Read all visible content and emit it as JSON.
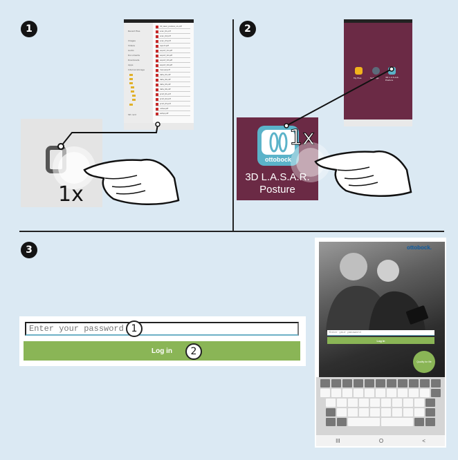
{
  "steps": {
    "step1": "1",
    "step2": "2",
    "step3": "3"
  },
  "panel1": {
    "tap_count": "1x",
    "sidebar_labels": [
      "Recent files",
      "Images",
      "Videos",
      "Audio",
      "Documents",
      "Downloads",
      "Apps",
      "Internal storage",
      "SD card"
    ],
    "files": [
      "3d_lasar_posture_v1.pdf",
      "scan_01.pdf",
      "scan_02.pdf",
      "scan_03.pdf",
      "report.pdf",
      "export_01.pdf",
      "export_02.pdf",
      "export_03.pdf",
      "export_04.pdf",
      "manual.pdf",
      "data_01.pdf",
      "data_02.pdf",
      "data_03.pdf",
      "data_04.pdf",
      "print_01.pdf",
      "print_02.pdf",
      "print_03.pdf",
      "notes.pdf",
      "setup.pdf"
    ]
  },
  "panel2": {
    "tap_count": "1x",
    "app_name": "3D L.A.S.A.R. Posture",
    "icon_brand": "ottobock",
    "home_apps": [
      "My files",
      "Settings",
      "3D L.A.S.A.R. Posture"
    ]
  },
  "panel3": {
    "password_placeholder": "Enter your password",
    "login_label": "Log in",
    "marker_input": "1",
    "marker_button": "2",
    "tablet": {
      "logo": "ottobock.",
      "password_placeholder": "Enter your password",
      "login_label": "Log in",
      "badge": "Quality for life",
      "nav": [
        "III",
        "O",
        "<"
      ]
    }
  },
  "colors": {
    "background": "#dbe9f3",
    "plum": "#6b2a45",
    "teal": "#5bb3c9",
    "green": "#8ab556",
    "brand_blue": "#0b5aa0"
  }
}
